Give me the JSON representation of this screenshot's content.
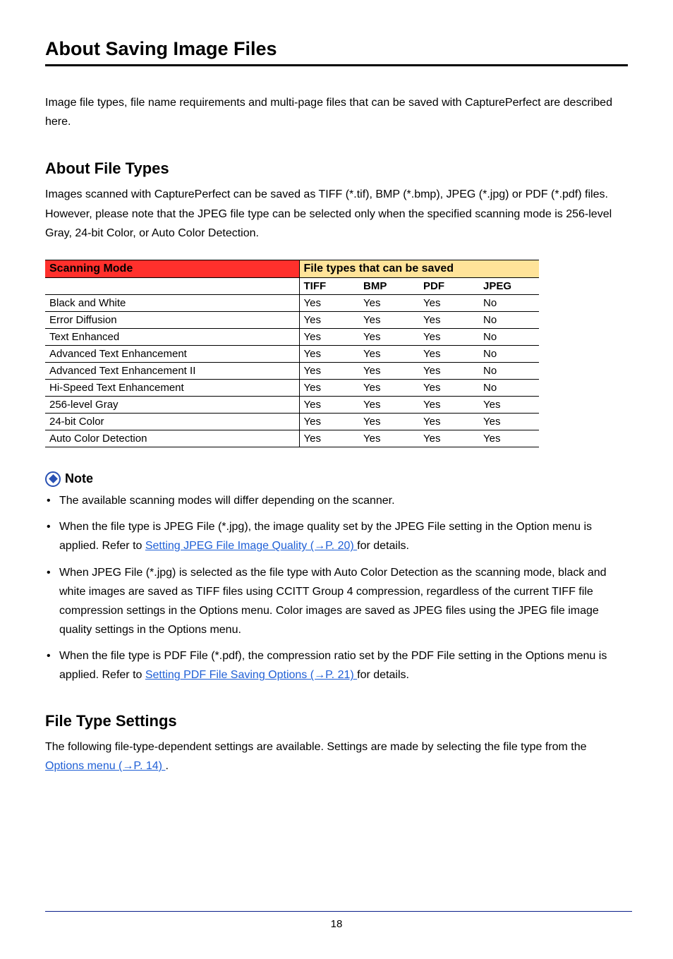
{
  "title": "About Saving Image Files",
  "intro": "Image file types, file name requirements and multi-page files that can be saved with CapturePerfect are described here.",
  "section1": {
    "heading": "About File Types",
    "para": "Images scanned with CapturePerfect can be saved as TIFF (*.tif), BMP (*.bmp), JPEG (*.jpg) or PDF (*.pdf) files. However, please note that the JPEG file type can be selected only when the specified scanning mode is 256-level Gray, 24-bit Color, or Auto Color Detection."
  },
  "table": {
    "h_scan": "Scanning Mode",
    "h_file": "File types that can be saved",
    "cols": [
      "TIFF",
      "BMP",
      "PDF",
      "JPEG"
    ],
    "rows": [
      {
        "label": "Black and White",
        "v": [
          "Yes",
          "Yes",
          "Yes",
          "No"
        ]
      },
      {
        "label": "Error Diffusion",
        "v": [
          "Yes",
          "Yes",
          "Yes",
          "No"
        ]
      },
      {
        "label": "Text Enhanced",
        "v": [
          "Yes",
          "Yes",
          "Yes",
          "No"
        ]
      },
      {
        "label": "Advanced Text Enhancement",
        "v": [
          "Yes",
          "Yes",
          "Yes",
          "No"
        ]
      },
      {
        "label": "Advanced Text Enhancement II",
        "v": [
          "Yes",
          "Yes",
          "Yes",
          "No"
        ]
      },
      {
        "label": "Hi-Speed Text Enhancement",
        "v": [
          "Yes",
          "Yes",
          "Yes",
          "No"
        ]
      },
      {
        "label": "256-level Gray",
        "v": [
          "Yes",
          "Yes",
          "Yes",
          "Yes"
        ]
      },
      {
        "label": "24-bit Color",
        "v": [
          "Yes",
          "Yes",
          "Yes",
          "Yes"
        ]
      },
      {
        "label": "Auto Color Detection",
        "v": [
          "Yes",
          "Yes",
          "Yes",
          "Yes"
        ]
      }
    ]
  },
  "note_label": "Note",
  "notes": {
    "n1": "The available scanning modes will differ depending on the scanner.",
    "n2a": "When the file type is JPEG File (*.jpg), the image quality set by the JPEG File setting in the Option menu is applied. Refer to ",
    "n2link": "Setting JPEG File Image Quality (→P. 20) ",
    "n2b": " for details.",
    "n3": "When JPEG File (*.jpg) is selected as the file type with Auto Color Detection as the scanning mode, black and white images are saved as TIFF files using CCITT Group 4 compression, regardless of the current TIFF file compression settings in the Options menu. Color images are saved as JPEG files using the JPEG file image quality settings in the Options menu.",
    "n4a": "When the file type is PDF File (*.pdf), the compression ratio set by the PDF File setting in the Options menu is applied. Refer to ",
    "n4link": "Setting PDF File Saving Options (→P. 21) ",
    "n4b": " for details."
  },
  "section2": {
    "heading": "File Type Settings",
    "para_a": "The following file-type-dependent settings are available. Settings are made by selecting the file type from the ",
    "link": "Options menu (→P. 14) ",
    "para_b": "."
  },
  "page_number": "18"
}
